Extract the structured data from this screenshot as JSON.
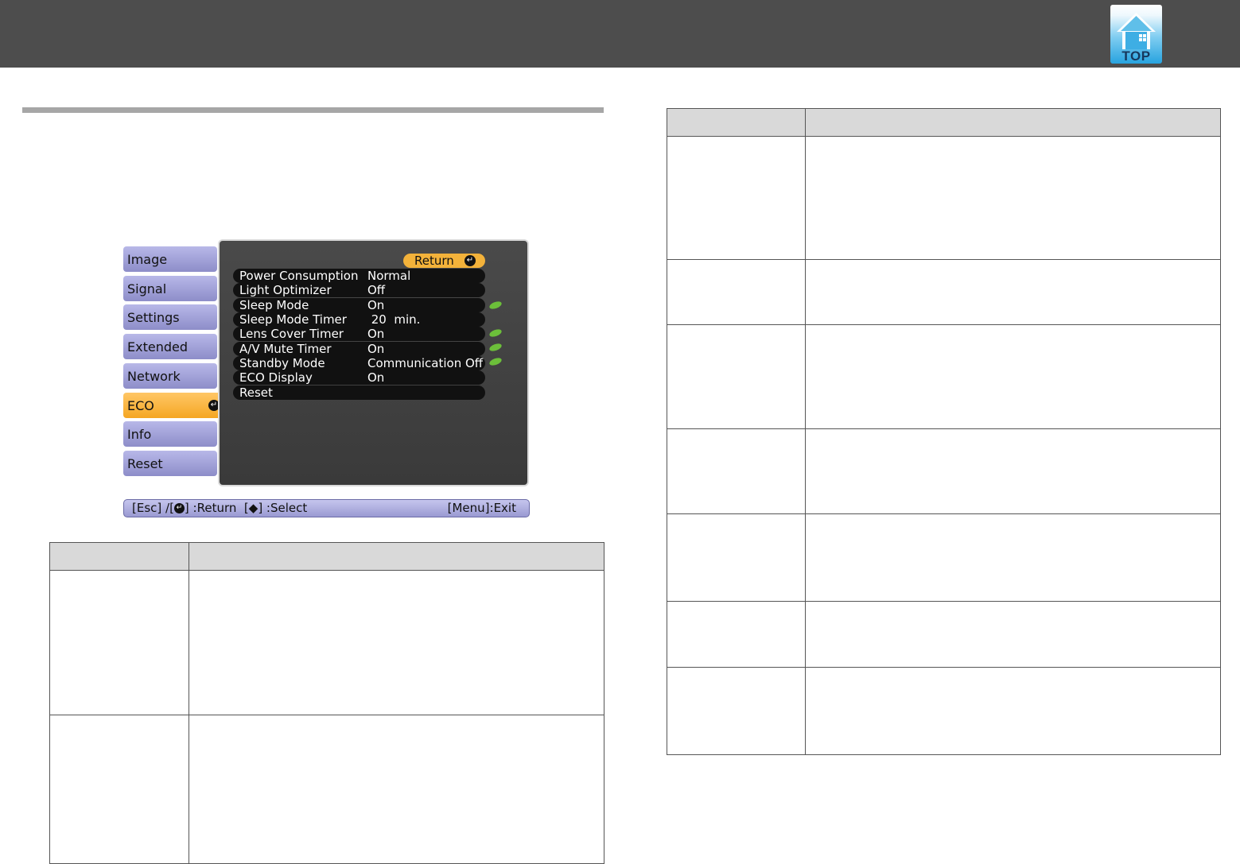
{
  "header": {
    "logo_text": "TOP",
    "logo_icon": "home-icon"
  },
  "osd": {
    "tabs": [
      {
        "label": "Image"
      },
      {
        "label": "Signal"
      },
      {
        "label": "Settings"
      },
      {
        "label": "Extended"
      },
      {
        "label": "Network"
      },
      {
        "label": "ECO",
        "active": true
      },
      {
        "label": "Info"
      },
      {
        "label": "Reset"
      }
    ],
    "return_label": "Return",
    "rows": [
      {
        "label": "Power Consumption",
        "value": "Normal",
        "eco_leaf": false
      },
      {
        "label": "Light Optimizer",
        "value": "Off",
        "eco_leaf": false
      },
      {
        "label": "Sleep Mode",
        "value": "On",
        "eco_leaf": true
      },
      {
        "label": "Sleep Mode Timer",
        "value": " 20  min.",
        "eco_leaf": false
      },
      {
        "label": "Lens Cover Timer",
        "value": "On",
        "eco_leaf": true
      },
      {
        "label": "A/V Mute Timer",
        "value": "On",
        "eco_leaf": true
      },
      {
        "label": "Standby Mode",
        "value": "Communication Off",
        "eco_leaf": true
      },
      {
        "label": "ECO Display",
        "value": "On",
        "eco_leaf": false
      },
      {
        "label": "Reset",
        "value": "",
        "eco_leaf": false
      }
    ],
    "bottom_bar": {
      "esc_part": "[Esc] /[",
      "return_part": "] :Return  [",
      "select_part": "] :Select",
      "exit": "[Menu]:Exit"
    },
    "colors": {
      "active_tab": "#f5a623",
      "tab": "#a0a0d8",
      "panel": "#444444",
      "leaf": "#6cbf3a"
    }
  }
}
